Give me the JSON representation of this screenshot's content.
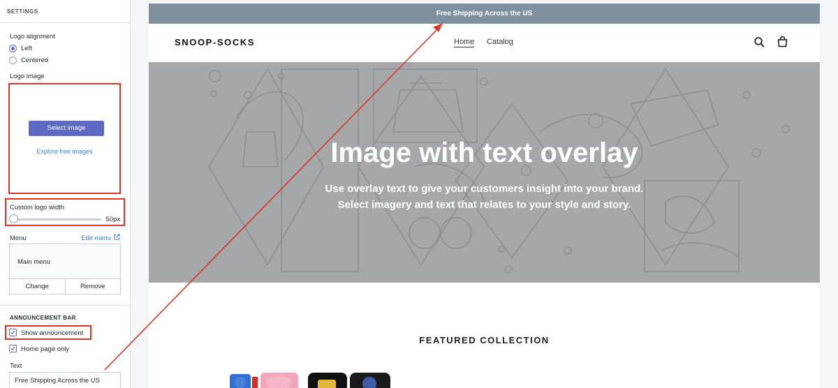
{
  "sidebar": {
    "section_title": "SETTINGS",
    "logo_alignment": {
      "label": "Logo alignment",
      "options": [
        "Left",
        "Centered"
      ],
      "selected": "Left"
    },
    "logo_image": {
      "label": "Logo image",
      "select_button": "Select image",
      "explore_link": "Explore free images"
    },
    "custom_logo_width": {
      "label": "Custom logo width",
      "value": "50px",
      "slider_fraction": 0
    },
    "menu": {
      "label": "Menu",
      "edit_link": "Edit menu",
      "current": "Main menu",
      "change_button": "Change",
      "remove_button": "Remove"
    },
    "announcement_bar": {
      "heading": "ANNOUNCEMENT BAR",
      "show_announcement": {
        "label": "Show announcement",
        "checked": true
      },
      "home_page_only": {
        "label": "Home page only",
        "checked": true
      },
      "text_label": "Text",
      "text_value": "Free Shipping Across the US"
    }
  },
  "preview": {
    "announcement_text": "Free Shipping Across the US",
    "brand": "SNOOP-SOCKS",
    "nav": [
      "Home",
      "Catalog"
    ],
    "active_nav": "Home",
    "hero": {
      "title": "Image with text overlay",
      "subtitle_line1": "Use overlay text to give your customers insight into your brand.",
      "subtitle_line2": "Select imagery and text that relates to your style and story."
    },
    "featured_heading": "FEATURED COLLECTION"
  },
  "colors": {
    "accent": "#5c6ac4",
    "highlight": "#d9352b",
    "announcement_bg": "#7f919e",
    "hero_bg": "#a6a7a9"
  }
}
